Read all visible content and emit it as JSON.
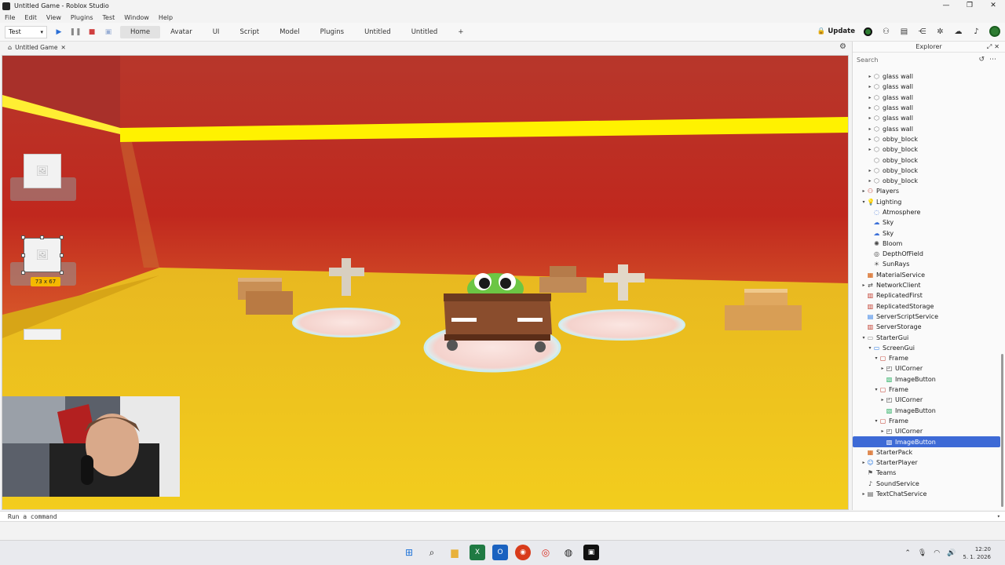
{
  "window": {
    "title": "Untitled Game - Roblox Studio",
    "controls": [
      "—",
      "❐",
      "✕"
    ]
  },
  "menu": [
    "File",
    "Edit",
    "View",
    "Plugins",
    "Test",
    "Window",
    "Help"
  ],
  "toolbar": {
    "mode_select": "Test",
    "tabs": [
      "Home",
      "Avatar",
      "UI",
      "Script",
      "Model",
      "Plugins",
      "Untitled",
      "Untitled"
    ],
    "active_tab": "Home",
    "more": "+",
    "update_label": "Update"
  },
  "document_tab": {
    "label": "Untitled Game",
    "close": "✕"
  },
  "viewport": {
    "selection_size": "73 x 67"
  },
  "explorer": {
    "title": "Explorer",
    "search_placeholder": "Search",
    "tree": [
      {
        "label": "glass wall",
        "indent": 2,
        "arrow": "▸",
        "icon": "part"
      },
      {
        "label": "glass wall",
        "indent": 2,
        "arrow": "▸",
        "icon": "part"
      },
      {
        "label": "glass wall",
        "indent": 2,
        "arrow": "▸",
        "icon": "part"
      },
      {
        "label": "glass wall",
        "indent": 2,
        "arrow": "▸",
        "icon": "part"
      },
      {
        "label": "glass wall",
        "indent": 2,
        "arrow": "▸",
        "icon": "part"
      },
      {
        "label": "glass wall",
        "indent": 2,
        "arrow": "▸",
        "icon": "part"
      },
      {
        "label": "obby_block",
        "indent": 2,
        "arrow": "▸",
        "icon": "part"
      },
      {
        "label": "obby_block",
        "indent": 2,
        "arrow": "▸",
        "icon": "part"
      },
      {
        "label": "obby_block",
        "indent": 2,
        "arrow": "",
        "icon": "part"
      },
      {
        "label": "obby_block",
        "indent": 2,
        "arrow": "▸",
        "icon": "part"
      },
      {
        "label": "obby_block",
        "indent": 2,
        "arrow": "▸",
        "icon": "part"
      },
      {
        "label": "Players",
        "indent": 1,
        "arrow": "▸",
        "icon": "players"
      },
      {
        "label": "Lighting",
        "indent": 1,
        "arrow": "▾",
        "icon": "lighting"
      },
      {
        "label": "Atmosphere",
        "indent": 2,
        "arrow": "",
        "icon": "atmosphere"
      },
      {
        "label": "Sky",
        "indent": 2,
        "arrow": "",
        "icon": "sky"
      },
      {
        "label": "Sky",
        "indent": 2,
        "arrow": "",
        "icon": "sky"
      },
      {
        "label": "Bloom",
        "indent": 2,
        "arrow": "",
        "icon": "bloom"
      },
      {
        "label": "DepthOfField",
        "indent": 2,
        "arrow": "",
        "icon": "dof"
      },
      {
        "label": "SunRays",
        "indent": 2,
        "arrow": "",
        "icon": "sunrays"
      },
      {
        "label": "MaterialService",
        "indent": 1,
        "arrow": "",
        "icon": "service"
      },
      {
        "label": "NetworkClient",
        "indent": 1,
        "arrow": "▸",
        "icon": "network"
      },
      {
        "label": "ReplicatedFirst",
        "indent": 1,
        "arrow": "",
        "icon": "replicated"
      },
      {
        "label": "ReplicatedStorage",
        "indent": 1,
        "arrow": "",
        "icon": "replicated"
      },
      {
        "label": "ServerScriptService",
        "indent": 1,
        "arrow": "",
        "icon": "script-service"
      },
      {
        "label": "ServerStorage",
        "indent": 1,
        "arrow": "",
        "icon": "storage"
      },
      {
        "label": "StarterGui",
        "indent": 1,
        "arrow": "▾",
        "icon": "gui"
      },
      {
        "label": "ScreenGui",
        "indent": 2,
        "arrow": "▾",
        "icon": "screengui"
      },
      {
        "label": "Frame",
        "indent": 3,
        "arrow": "▾",
        "icon": "frame"
      },
      {
        "label": "UICorner",
        "indent": 4,
        "arrow": "▸",
        "icon": "uicorner"
      },
      {
        "label": "ImageButton",
        "indent": 4,
        "arrow": "",
        "icon": "imagebutton"
      },
      {
        "label": "Frame",
        "indent": 3,
        "arrow": "▾",
        "icon": "frame"
      },
      {
        "label": "UICorner",
        "indent": 4,
        "arrow": "▸",
        "icon": "uicorner"
      },
      {
        "label": "ImageButton",
        "indent": 4,
        "arrow": "",
        "icon": "imagebutton"
      },
      {
        "label": "Frame",
        "indent": 3,
        "arrow": "▾",
        "icon": "frame"
      },
      {
        "label": "UICorner",
        "indent": 4,
        "arrow": "▸",
        "icon": "uicorner"
      },
      {
        "label": "ImageButton",
        "indent": 4,
        "arrow": "",
        "icon": "imagebutton",
        "selected": true
      },
      {
        "label": "StarterPack",
        "indent": 1,
        "arrow": "",
        "icon": "pack"
      },
      {
        "label": "StarterPlayer",
        "indent": 1,
        "arrow": "▸",
        "icon": "player"
      },
      {
        "label": "Teams",
        "indent": 1,
        "arrow": "",
        "icon": "teams"
      },
      {
        "label": "SoundService",
        "indent": 1,
        "arrow": "",
        "icon": "sound"
      },
      {
        "label": "TextChatService",
        "indent": 1,
        "arrow": "▸",
        "icon": "chat"
      }
    ]
  },
  "command_bar": {
    "placeholder": "Run a command"
  },
  "taskbar": {
    "time": "12:20",
    "date": "5. 1. 2026"
  },
  "colors": {
    "accent": "#3d6ad6",
    "sky_red": "#c8281c",
    "floor_yellow": "#f1c40f"
  }
}
